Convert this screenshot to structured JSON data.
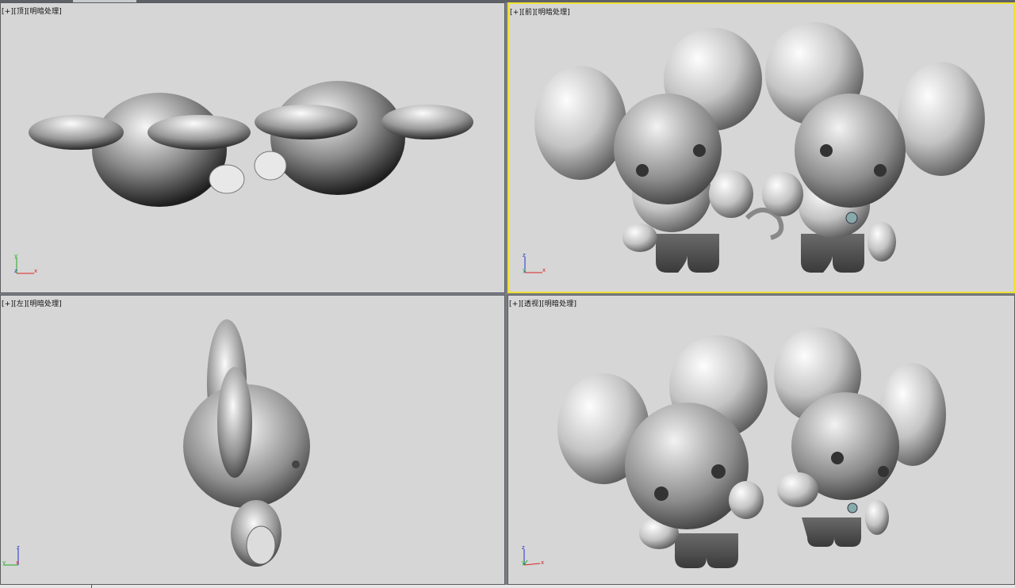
{
  "viewports": [
    {
      "id": "top",
      "plus": "[+]",
      "view": "[顶]",
      "shading": "[明暗处理]",
      "axis_v": "y",
      "axis_h": "x",
      "axis_o": "z"
    },
    {
      "id": "front",
      "plus": "[+]",
      "view": "[前]",
      "shading": "[明暗处理]",
      "axis_v": "z",
      "axis_h": "x",
      "axis_o": "y"
    },
    {
      "id": "left",
      "plus": "[+]",
      "view": "[左]",
      "shading": "[明暗处理]",
      "axis_v": "z",
      "axis_h": "y",
      "axis_o": "x"
    },
    {
      "id": "perspective",
      "plus": "[+]",
      "view": "[透视]",
      "shading": "[明暗处理]",
      "axis_v": "z",
      "axis_h": "x",
      "axis_o": "y"
    }
  ],
  "active_viewport": "front",
  "colors": {
    "viewport_bg": "#d6d6d6",
    "active_border": "#f0e033",
    "axis_x": "#d22",
    "axis_y": "#2a2",
    "axis_z": "#23c"
  }
}
